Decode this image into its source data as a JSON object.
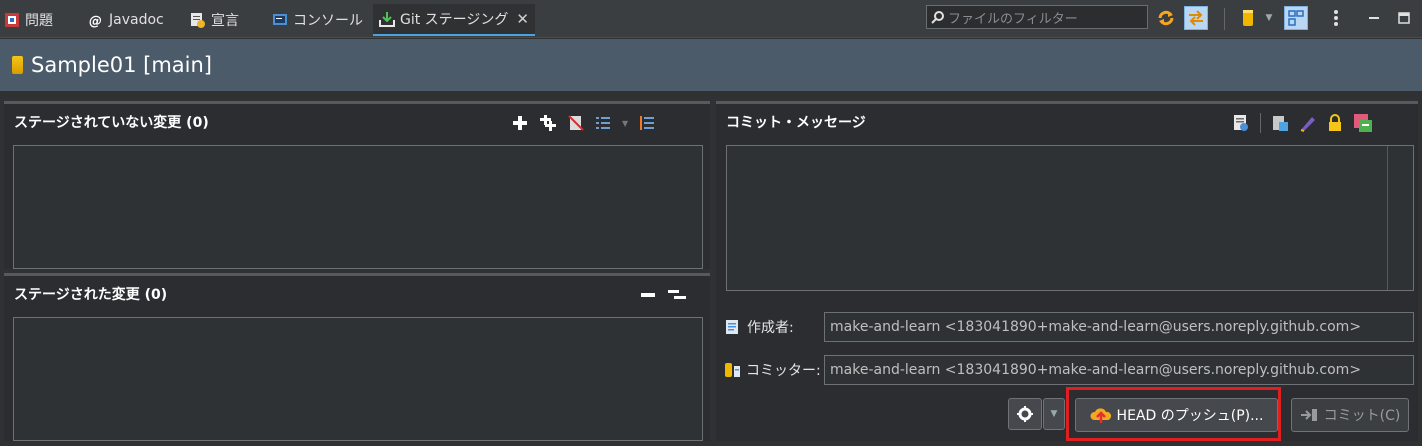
{
  "tabs": [
    {
      "label": "問題",
      "icon": "problems-icon"
    },
    {
      "label": "Javadoc",
      "icon": "javadoc-icon"
    },
    {
      "label": "宣言",
      "icon": "declaration-icon"
    },
    {
      "label": "コンソール",
      "icon": "console-icon"
    },
    {
      "label": "Git ステージング",
      "icon": "git-staging-icon",
      "active": true
    }
  ],
  "filter": {
    "placeholder": "ファイルのフィルター"
  },
  "header": {
    "title": "Sample01 [main]"
  },
  "unstaged": {
    "title": "ステージされていない変更 (0)"
  },
  "staged": {
    "title": "ステージされた変更 (0)"
  },
  "commit": {
    "title": "コミット・メッセージ",
    "author_label": "作成者:",
    "author_value": "make-and-learn <183041890+make-and-learn@users.noreply.github.com>",
    "committer_label": "コミッター:",
    "committer_value": "make-and-learn <183041890+make-and-learn@users.noreply.github.com>",
    "push_button": "HEAD のプッシュ(P)...",
    "commit_button": "コミット(C)"
  },
  "colors": {
    "accent": "#4aa3df",
    "highlight": "#e02020",
    "header_bg": "#4c5b6a"
  }
}
